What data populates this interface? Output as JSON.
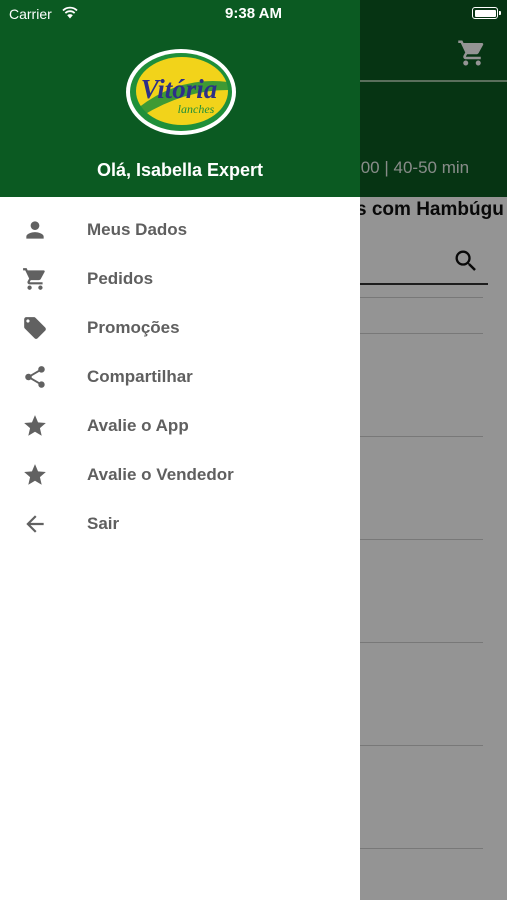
{
  "status_bar": {
    "carrier": "Carrier",
    "time": "9:38 AM"
  },
  "drawer": {
    "logo": {
      "brand": "Vitória",
      "sub": "lanches"
    },
    "greeting": "Olá, Isabella Expert",
    "items": [
      {
        "label": "Meus Dados",
        "icon": "person-icon"
      },
      {
        "label": "Pedidos",
        "icon": "cart-icon"
      },
      {
        "label": "Promoções",
        "icon": "tag-icon"
      },
      {
        "label": "Compartilhar",
        "icon": "share-icon"
      },
      {
        "label": "Avalie o App",
        "icon": "star-icon"
      },
      {
        "label": "Avalie o Vendedor",
        "icon": "star-icon"
      },
      {
        "label": "Sair",
        "icon": "arrow-back-icon"
      }
    ]
  },
  "background": {
    "delivery_info": ".00 | 40-50 min",
    "section_title": "s com Hambúgu"
  },
  "colors": {
    "primary_green": "#0b5a22",
    "menu_text": "#5f5f5f",
    "icon_gray": "#616161",
    "logo_yellow": "#f2d31a"
  }
}
